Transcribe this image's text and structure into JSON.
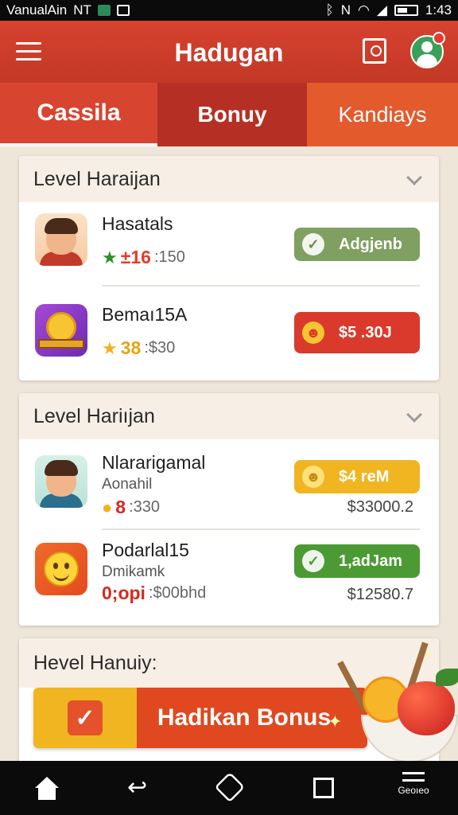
{
  "status_bar": {
    "carrier": "VanualAin",
    "network_tag": "NT",
    "time": "1:43"
  },
  "app_bar": {
    "title": "Hadugan"
  },
  "tabs": [
    {
      "label": "Cassila"
    },
    {
      "label": "Bonuy"
    },
    {
      "label": "Kandiays"
    }
  ],
  "sections": [
    {
      "title": "Level Haraijan",
      "items": [
        {
          "name": "Hasatals",
          "badge": "±16",
          "stat": ":150",
          "action": "Adgjenb",
          "action_icon": "✓"
        },
        {
          "name": "Bemaı15A",
          "badge": "38",
          "stat": ":$30",
          "action": "$5 .30J",
          "action_icon": "☻"
        }
      ]
    },
    {
      "title": "Level Hariıjan",
      "items": [
        {
          "name": "Nlararigamal",
          "sub": "Aonahil",
          "badge": "8",
          "stat": ":330",
          "action": "$4 reM",
          "action_icon": "☻",
          "amount": "$33000.2"
        },
        {
          "name": "Podarlal15",
          "sub": "Dmikamk",
          "badge": "0;opi",
          "stat": ":$00bhd",
          "action": "1,adJam",
          "action_icon": "✓",
          "amount": "$12580.7"
        }
      ]
    }
  ],
  "bonus_section": {
    "title": "Hevel Hanuiy:",
    "button_label": "Hadikan Bonus"
  },
  "nav_bar": {
    "menu_label": "Geoıeo"
  },
  "colors": {
    "primary": "#d6422f",
    "accent_orange": "#e0481f",
    "accent_yellow": "#f0b521",
    "success_green": "#4b9a34"
  }
}
